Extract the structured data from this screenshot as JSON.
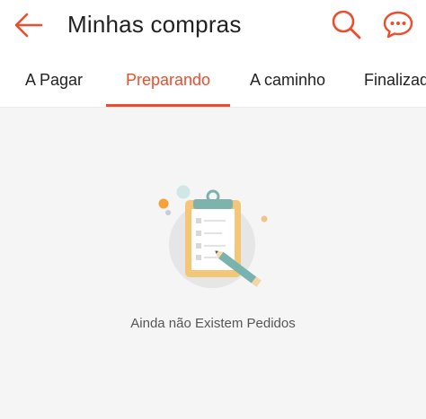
{
  "header": {
    "title": "Minhas compras",
    "back_icon": "arrow-left-icon",
    "search_icon": "search-icon",
    "chat_icon": "chat-bubble-icon",
    "accent_color": "#ee4d2d"
  },
  "tabs": [
    {
      "label": "A Pagar",
      "active": false
    },
    {
      "label": "Preparando",
      "active": true
    },
    {
      "label": "A caminho",
      "active": false
    },
    {
      "label": "Finalizado",
      "active": false
    }
  ],
  "empty_state": {
    "icon": "clipboard-pencil-icon",
    "message": "Ainda não Existem Pedidos"
  }
}
